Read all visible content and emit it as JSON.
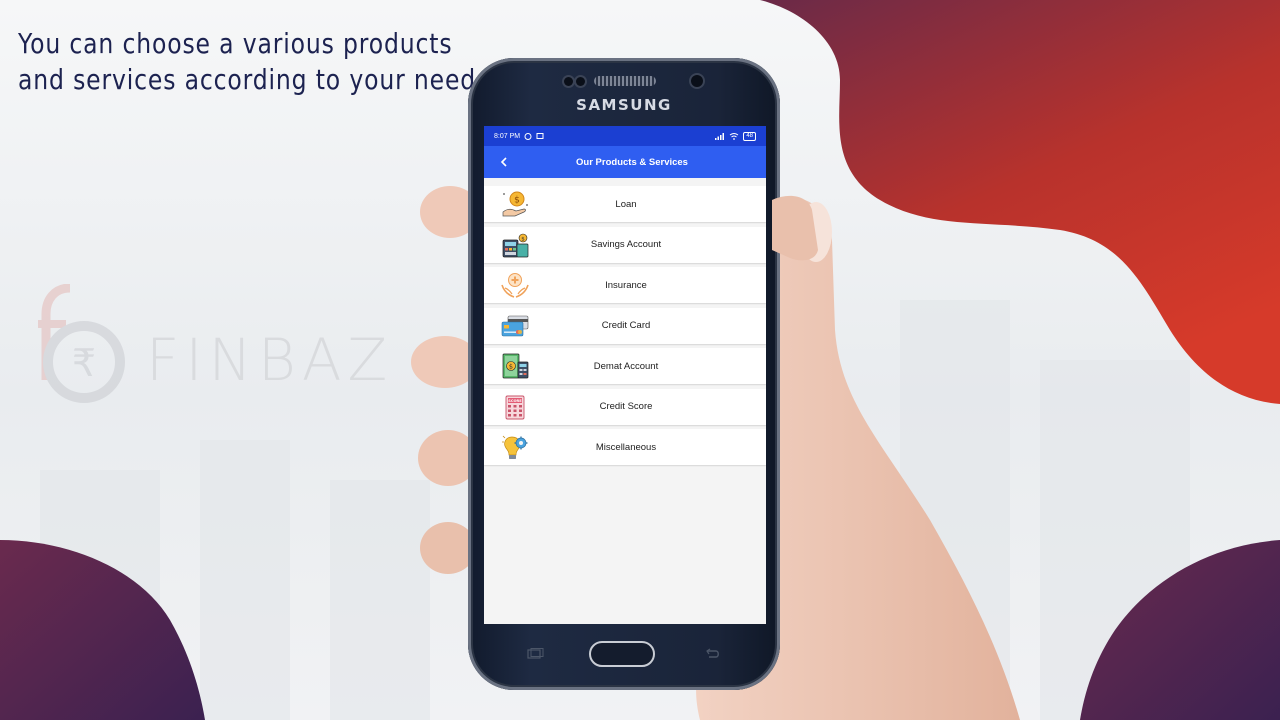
{
  "headline": {
    "line1": "You can choose a various products",
    "line2": "and services according to your need"
  },
  "logo": {
    "text": "FINBAZ",
    "icon": "rupee-icon"
  },
  "phone": {
    "brand": "SAMSUNG",
    "status_bar": {
      "time": "8:07 PM",
      "battery": "48"
    },
    "app_bar": {
      "title": "Our Products & Services",
      "back_icon": "back-chevron-icon"
    },
    "items": [
      {
        "label": "Loan",
        "icon": "loan-hand-coin-icon"
      },
      {
        "label": "Savings Account",
        "icon": "savings-calculator-icon"
      },
      {
        "label": "Insurance",
        "icon": "insurance-hands-icon"
      },
      {
        "label": "Credit Card",
        "icon": "credit-card-icon"
      },
      {
        "label": "Demat Account",
        "icon": "demat-money-icon"
      },
      {
        "label": "Credit Score",
        "icon": "credit-score-icon"
      },
      {
        "label": "Miscellaneous",
        "icon": "miscellaneous-bulb-icon"
      }
    ]
  },
  "colors": {
    "accent_blue": "#2f5ef1",
    "status_blue": "#1b3fd2",
    "headline_navy": "#1c2250",
    "blob_red": "#d63a2a",
    "blob_purple": "#4a2448"
  }
}
